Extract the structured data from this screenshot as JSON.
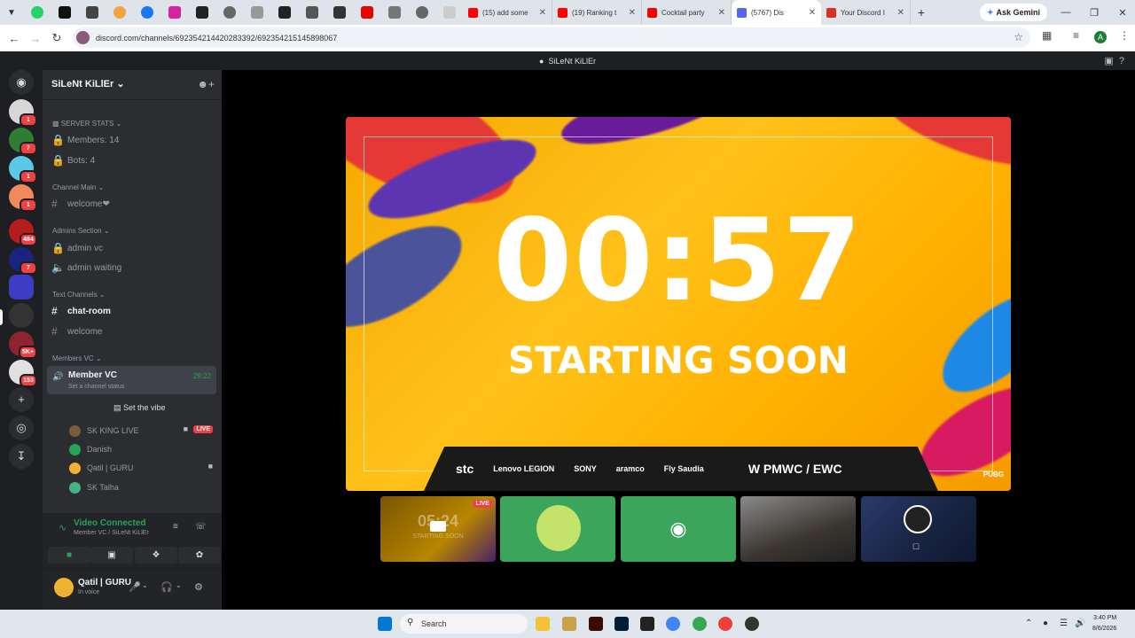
{
  "browser": {
    "tabs": [
      {
        "title": "(15) add some",
        "color": "#ff0000"
      },
      {
        "title": "(19) Ranking t",
        "color": "#ff0000"
      },
      {
        "title": "Cocktail party",
        "color": "#ff0000"
      },
      {
        "title": "(5767) Dis",
        "color": "#5865f2",
        "active": true
      },
      {
        "title": "Your Discord I",
        "color": "#d93025"
      }
    ],
    "ask_gemini": "Ask Gemini",
    "url": "discord.com/channels/692354214420283392/692354215145898067",
    "profile_initial": "A"
  },
  "discord": {
    "window_title": "SiLeNt KiLlEr",
    "server_name": "SiLeNt KiLlEr",
    "rail_badges": [
      "1",
      "7",
      "1",
      "1",
      "484",
      "7",
      "5K+",
      "153"
    ],
    "categories": {
      "server_stats": "SERVER STATS",
      "channel_main": "Channel Main",
      "admins": "Admins Section",
      "text": "Text Channels",
      "members_vc": "Members VC"
    },
    "channels": {
      "members": "Members: 14",
      "bots": "Bots: 4",
      "welcome_heart": "welcome❤",
      "admin_vc": "admin vc",
      "admin_waiting": "admin waiting",
      "chat_room": "chat-room",
      "welcome": "welcome"
    },
    "voice_channel": {
      "name": "Member VC",
      "status": "Set a channel status",
      "time": "29:22",
      "set_vibe": "Set the vibe"
    },
    "members": [
      {
        "name": "SK KING LIVE",
        "live": "LIVE"
      },
      {
        "name": "Danish"
      },
      {
        "name": "Qatil | GURU"
      },
      {
        "name": "SK Talha"
      }
    ],
    "voice_panel": {
      "title": "Video Connected",
      "subtitle": "Member VC / SiLeNt KiLlEr"
    },
    "user": {
      "name": "Qatil | GURU",
      "status": "In voice"
    },
    "stream": {
      "timer": "00:57",
      "caption": "STARTING SOON",
      "sponsors": [
        "stc",
        "Lenovo LEGION",
        "SONY",
        "aramco",
        "Fly Saudia",
        "W PMWC / EWC"
      ],
      "pubg_badge": "PUBG",
      "thumb_timer": "05:24",
      "thumb_caption": "STARTING SOON",
      "thumb_live": "LIVE"
    }
  },
  "taskbar": {
    "search_label": "Search",
    "time": "3:40 PM",
    "date": "8/6/2026"
  }
}
